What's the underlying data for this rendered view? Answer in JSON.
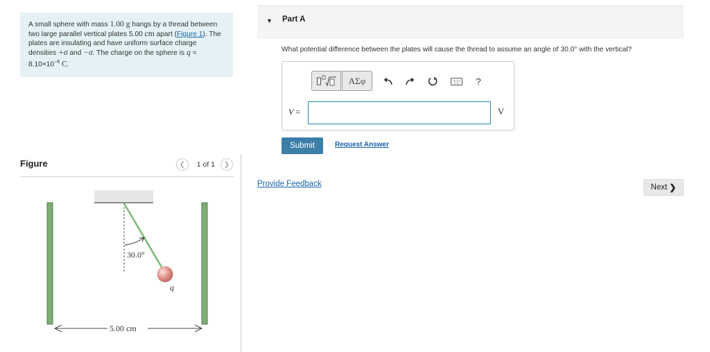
{
  "problem": {
    "text_1": "A small sphere with mass",
    "mass_value": "1.00",
    "mass_unit": "g",
    "text_2": "hangs by a thread between two large parallel vertical plates",
    "distance_value": "5.00",
    "distance_unit": "cm",
    "text_3": "apart",
    "figure_link": "Figure 1",
    "text_4": ". The plates are insulating and have uniform surface charge densities",
    "plus_sigma": "+σ",
    "text_and": "and",
    "minus_sigma": "−σ",
    "text_5": ". The charge on the sphere is",
    "charge_var": "q",
    "charge_eq": " = 8.10×10",
    "charge_exp": "−6",
    "charge_unit": "C",
    "period": "."
  },
  "figure": {
    "title": "Figure",
    "page_count": "1 of 1",
    "prev_icon": "chevron-left-icon",
    "next_icon": "chevron-right-icon",
    "angle_label": "30.0°",
    "charge_label": "q",
    "distance_label": "5.00 cm",
    "colors": {
      "plate": "#7fae74",
      "thread": "#7fba7a",
      "sphere": "#d98a80",
      "ceiling": "#e6e6e6"
    }
  },
  "part": {
    "caret_icon": "caret-down-icon",
    "title": "Part A",
    "question": "What potential difference between the plates will cause the thread to assume an angle of 30.0° with the vertical?"
  },
  "answer": {
    "toolbar": {
      "template_icon": "math-template-icon",
      "greek_label": "ΑΣφ",
      "undo_icon": "undo-icon",
      "redo_icon": "redo-icon",
      "reset_icon": "reset-icon",
      "keyboard_icon": "keyboard-icon",
      "help_label": "?"
    },
    "variable": "V",
    "equals": " =",
    "value": "",
    "unit": "V"
  },
  "actions": {
    "submit": "Submit",
    "request_answer": "Request Answer",
    "feedback": "Provide Feedback",
    "next": "Next",
    "next_icon": "chevron-right-icon"
  },
  "colors": {
    "accent": "#3b7ea8",
    "input_border": "#1f8aa9",
    "link": "#1a62a8",
    "problem_bg": "#e5f2f5"
  }
}
